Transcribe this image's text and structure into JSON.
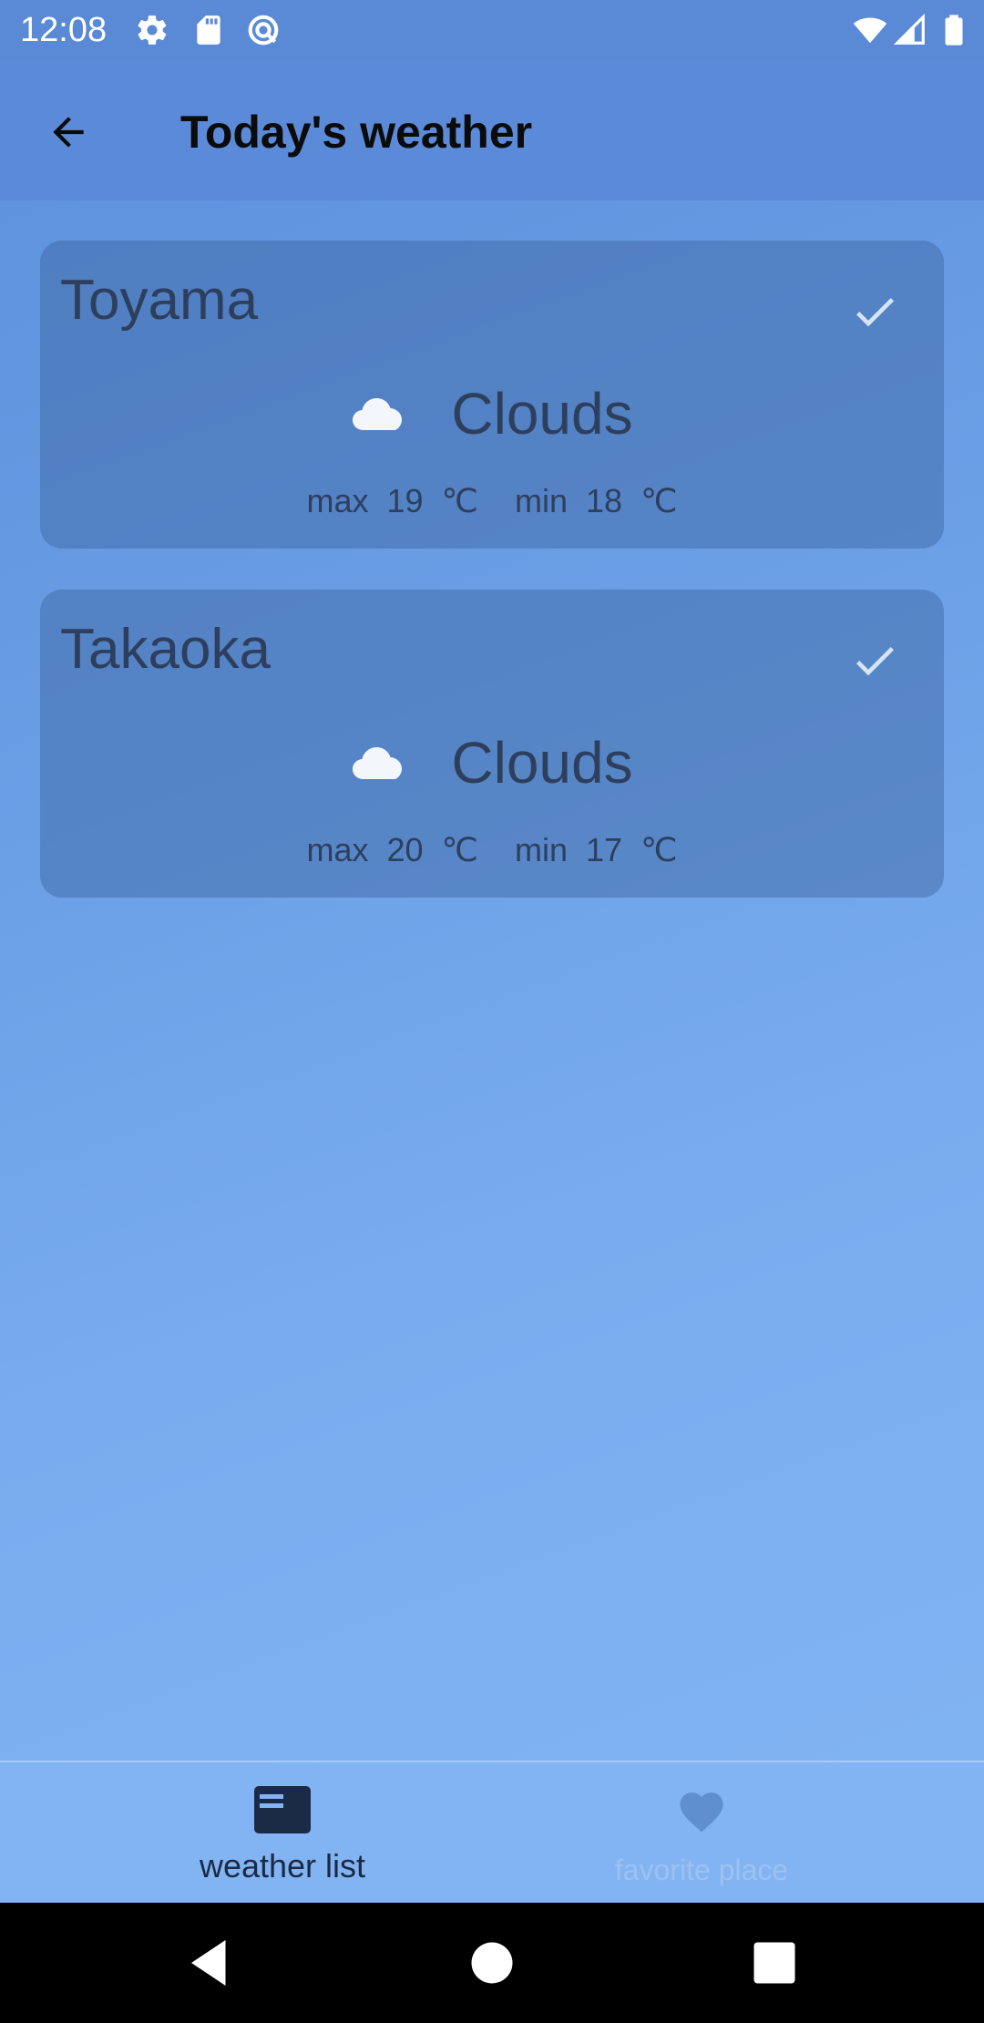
{
  "status_bar": {
    "time": "12:08",
    "left_icons": [
      "settings-icon",
      "sd-card-icon",
      "sync-icon"
    ],
    "right_icons": [
      "wifi-icon",
      "signal-icon",
      "battery-icon"
    ]
  },
  "app_bar": {
    "title": "Today's weather",
    "back_icon": "arrow-back-icon"
  },
  "cards": [
    {
      "city": "Toyama",
      "condition": "Clouds",
      "max_label": "max",
      "max_value": "19",
      "min_label": "min",
      "min_value": "18",
      "unit": "℃",
      "checked": true
    },
    {
      "city": "Takaoka",
      "condition": "Clouds",
      "max_label": "max",
      "max_value": "20",
      "min_label": "min",
      "min_value": "17",
      "unit": "℃",
      "checked": true
    }
  ],
  "bottom_nav": {
    "items": [
      {
        "label": "weather list",
        "icon": "list-card-icon",
        "active": true
      },
      {
        "label": "favorite place",
        "icon": "heart-icon",
        "active": false
      }
    ]
  },
  "colors": {
    "accent_dark": "#2e3f5e",
    "app_bar": "#5b8ad8",
    "bottom_nav": "#82b4f4"
  }
}
